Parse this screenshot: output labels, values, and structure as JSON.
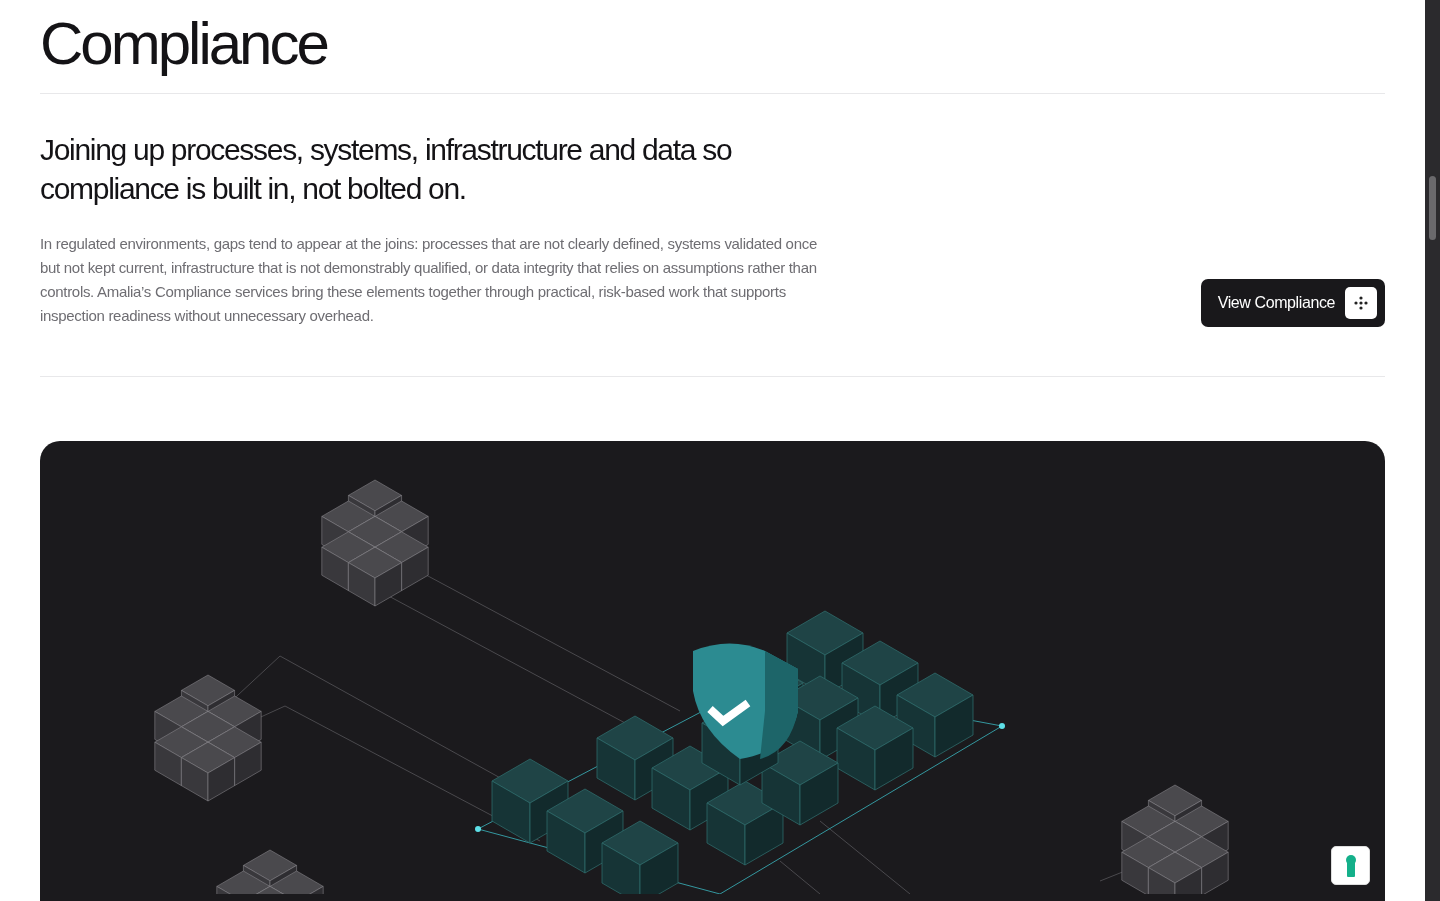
{
  "section": {
    "title": "Compliance"
  },
  "intro": {
    "headline": "Joining up processes, systems, infrastructure and data so compliance is built in, not bolted on.",
    "body": "In regulated environments, gaps tend to appear at the joins: processes that are not clearly defined, systems validated once but not kept current, infrastructure that is not demonstrably qualified, or data integrity that relies on assumptions rather than controls. Amalia’s Compliance services bring these elements together through practical, risk-based work that supports inspection readiness without unnecessary overhead.",
    "button": {
      "label": "View Compliance"
    }
  }
}
